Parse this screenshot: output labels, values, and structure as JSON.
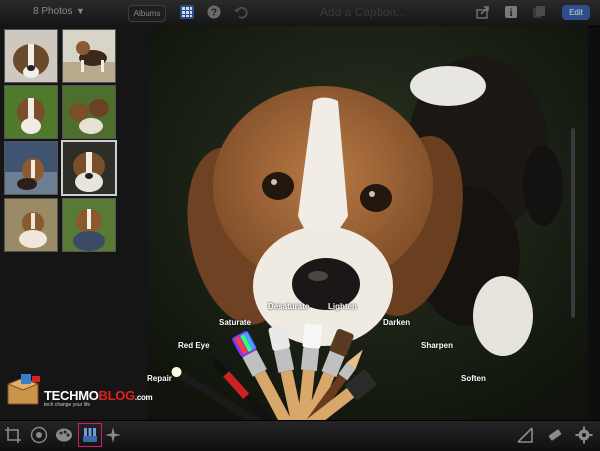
{
  "topbar": {
    "photos_count": "8 Photos",
    "albums_label": "Albums",
    "caption_placeholder": "Add a Caption...",
    "edit_label": "Edit"
  },
  "brushes": {
    "repair": "Repair",
    "red_eye": "Red Eye",
    "saturate": "Saturate",
    "desaturate": "Desaturate",
    "lighten": "Lighten",
    "darken": "Darken",
    "sharpen": "Sharpen",
    "soften": "Soften"
  },
  "watermark": {
    "brand_part1": "TECHMO",
    "brand_part2": "BLOG",
    "brand_suffix": ".com",
    "tagline": "tech change your life"
  },
  "colors": {
    "edit_button": "#2d4f8a",
    "brushes_tool_highlight": "#d0206b",
    "brand_red": "#e0201f"
  },
  "icons": [
    "chevron-down-icon",
    "grid-icon",
    "help-icon",
    "undo-icon",
    "share-icon",
    "info-icon",
    "copy-icon",
    "crop-icon",
    "exposure-icon",
    "color-palette-icon",
    "brushes-icon",
    "effects-icon",
    "shape-icon",
    "eraser-icon",
    "gear-icon"
  ]
}
